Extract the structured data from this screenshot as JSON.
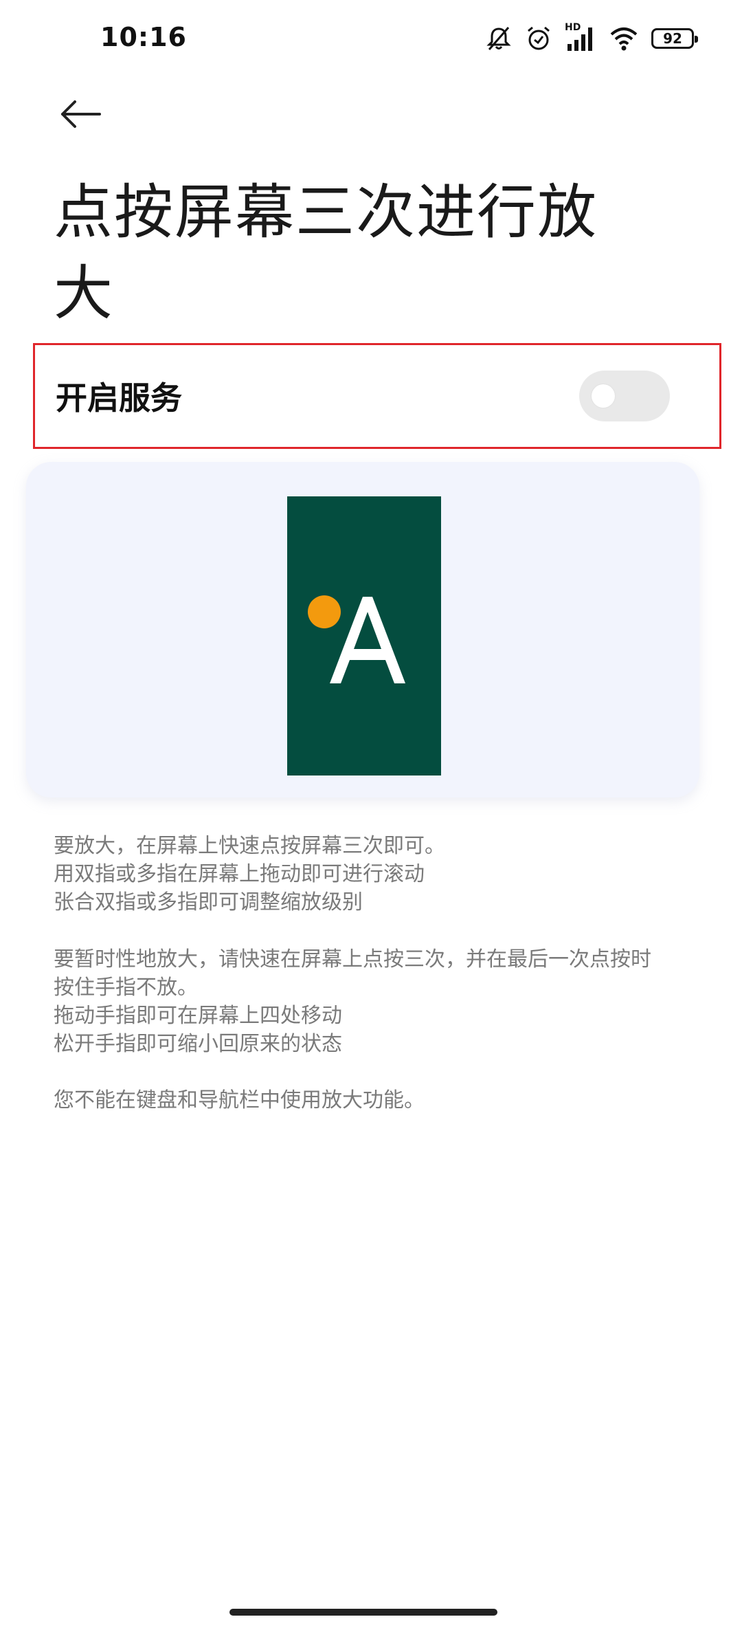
{
  "status_bar": {
    "time": "10:16",
    "battery_level": "92",
    "hd_label": "HD",
    "icons": [
      "bell-muted-icon",
      "alarm-clock-icon",
      "signal-icon",
      "wifi-icon",
      "battery-icon"
    ]
  },
  "header": {
    "back_icon": "arrow-left-icon",
    "title": "点按屏幕三次进行放大"
  },
  "service": {
    "label": "开启服务",
    "toggle_on": false
  },
  "preview": {
    "letter": "A",
    "colors": {
      "background": "#044d3f",
      "dot": "#f39a0e",
      "letter": "#ffffff"
    }
  },
  "description": {
    "paragraph1": [
      "要放大，在屏幕上快速点按屏幕三次即可。",
      "用双指或多指在屏幕上拖动即可进行滚动",
      "张合双指或多指即可调整缩放级别"
    ],
    "paragraph2": [
      "要暂时性地放大，请快速在屏幕上点按三次，并在最后一次点按时",
      "按住手指不放。",
      "拖动手指即可在屏幕上四处移动",
      "松开手指即可缩小回原来的状态"
    ],
    "paragraph3": [
      "您不能在键盘和导航栏中使用放大功能。"
    ]
  },
  "colors": {
    "highlight_border": "#e0262b",
    "toggle_off": "#e9e9e9",
    "card_background": "#f2f4fd",
    "description_text": "#7a7a7a"
  }
}
